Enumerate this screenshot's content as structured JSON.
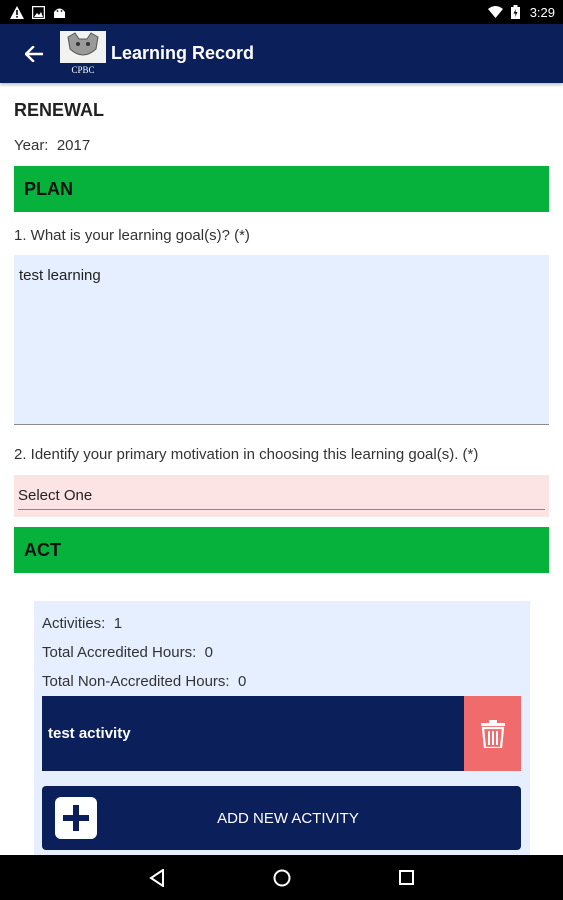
{
  "status_bar": {
    "time": "3:29",
    "left_icons": [
      "warning-icon",
      "image-icon",
      "android-icon"
    ],
    "right_icons": [
      "wifi-icon",
      "battery-icon"
    ]
  },
  "app_bar": {
    "title": "Learning Record",
    "logo_text": "CPBC",
    "color": "#0b1f5a"
  },
  "form": {
    "heading": "RENEWAL",
    "year_label": "Year:",
    "year_value": "2017",
    "plan_section": "PLAN",
    "question1": "1. What is your learning goal(s)? (*)",
    "goal_value": "test learning",
    "question2": "2. Identify your primary motivation in choosing this learning goal(s). (*)",
    "motivation_value": "Select One",
    "act_section": "ACT",
    "section_color": "#07b23c"
  },
  "activities": {
    "count_label": "Activities:",
    "count_value": "1",
    "accredited_label": "Total Accredited Hours:",
    "accredited_value": "0",
    "non_accredited_label": "Total Non-Accredited Hours:",
    "non_accredited_value": "0",
    "items": [
      {
        "name": "test activity"
      }
    ],
    "add_button_label": "ADD NEW ACTIVITY",
    "delete_color": "#f06b6b"
  },
  "nav_bar": {
    "buttons": [
      "back-triangle-icon",
      "home-circle-icon",
      "recents-square-icon"
    ]
  }
}
